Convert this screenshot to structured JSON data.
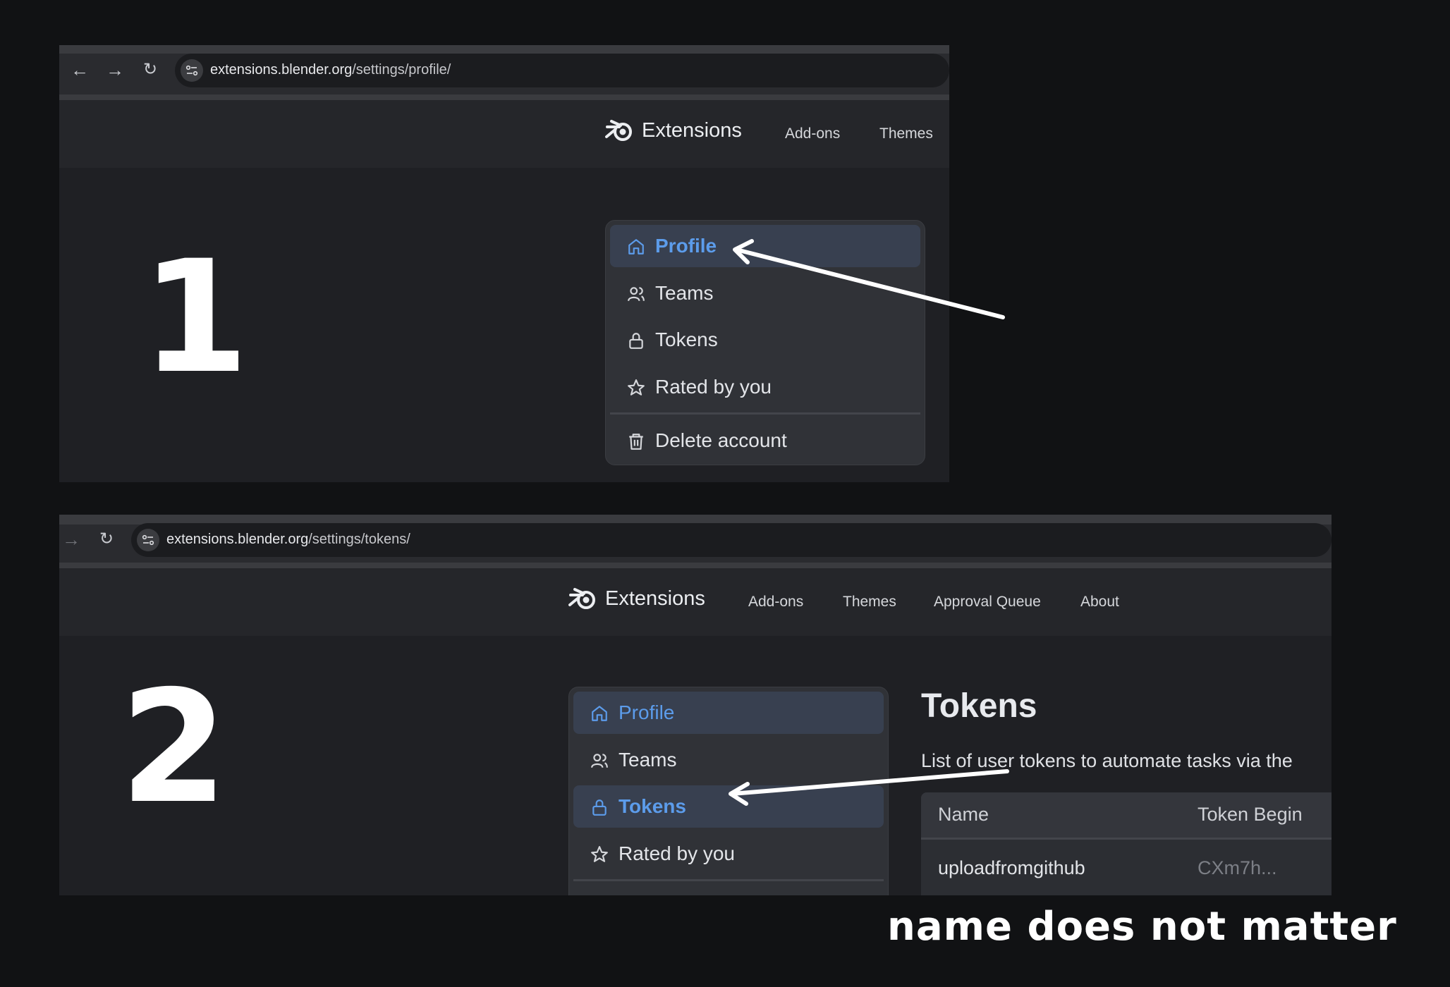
{
  "panel1": {
    "url_domain": "extensions.blender.org",
    "url_path": "/settings/profile/",
    "brand": "Extensions",
    "nav": [
      "Add-ons",
      "Themes"
    ],
    "step": "1",
    "menu": {
      "items": [
        {
          "label": "Profile",
          "icon": "home-icon"
        },
        {
          "label": "Teams",
          "icon": "users-icon"
        },
        {
          "label": "Tokens",
          "icon": "lock-icon"
        },
        {
          "label": "Rated by you",
          "icon": "star-icon"
        }
      ],
      "delete_label": "Delete account",
      "active": "Profile"
    }
  },
  "panel2": {
    "url_domain": "extensions.blender.org",
    "url_path": "/settings/tokens/",
    "brand": "Extensions",
    "nav": [
      "Add-ons",
      "Themes",
      "Approval Queue",
      "About"
    ],
    "step": "2",
    "menu": {
      "items": [
        {
          "label": "Profile",
          "icon": "home-icon"
        },
        {
          "label": "Teams",
          "icon": "users-icon"
        },
        {
          "label": "Tokens",
          "icon": "lock-icon"
        },
        {
          "label": "Rated by you",
          "icon": "star-icon"
        }
      ],
      "active": "Tokens"
    },
    "content": {
      "title": "Tokens",
      "description": "List of user tokens to automate tasks via the",
      "table": {
        "headers": [
          "Name",
          "Token Begin"
        ],
        "rows": [
          [
            "uploadfromgithub",
            "CXm7h..."
          ]
        ]
      }
    }
  },
  "annotation": "name does not matter",
  "colors": {
    "page_bg": "#111214",
    "panel_bg": "#1f2024",
    "accent": "#5c9ceb",
    "menu_bg": "#303237",
    "active_bg": "#384050"
  }
}
